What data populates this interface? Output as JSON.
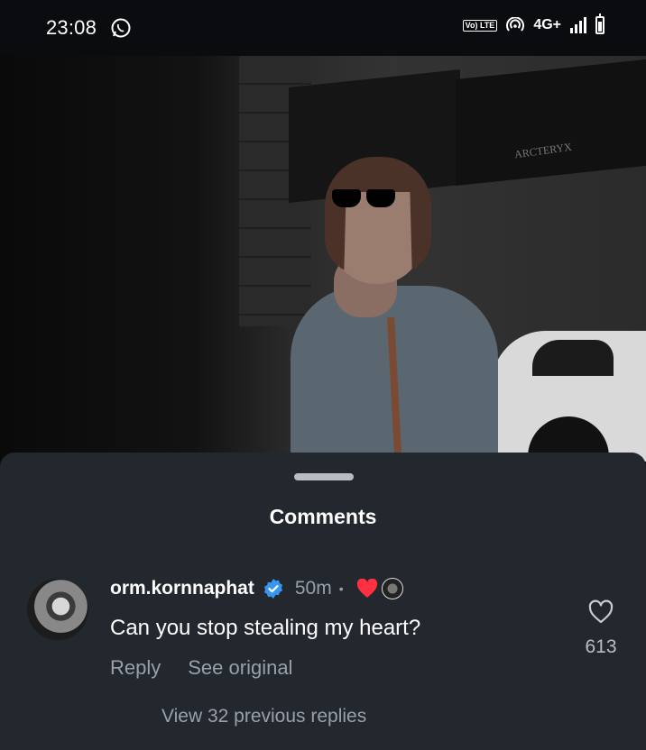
{
  "status_bar": {
    "time": "23:08",
    "icons": [
      "whatsapp-icon",
      "volte-icon",
      "hotspot-icon",
      "signal-icon",
      "battery-icon"
    ],
    "volte_label": "Vo) LTE",
    "network": "4G+"
  },
  "photo": {
    "sign_text": "ARCTERYX"
  },
  "comments_sheet": {
    "title": "Comments",
    "comment": {
      "username": "orm.kornnaphat",
      "verified": true,
      "time_ago": "50m",
      "separator": "•",
      "text": "Can you stop stealing my heart?",
      "reply_label": "Reply",
      "see_original_label": "See original",
      "like_count": "613"
    },
    "view_replies_label": "View 32 previous replies"
  },
  "colors": {
    "sheet_bg": "#23272e",
    "verified_blue": "#3797f0",
    "heart_red": "#ff3040",
    "muted_text": "#9aa0aa"
  }
}
